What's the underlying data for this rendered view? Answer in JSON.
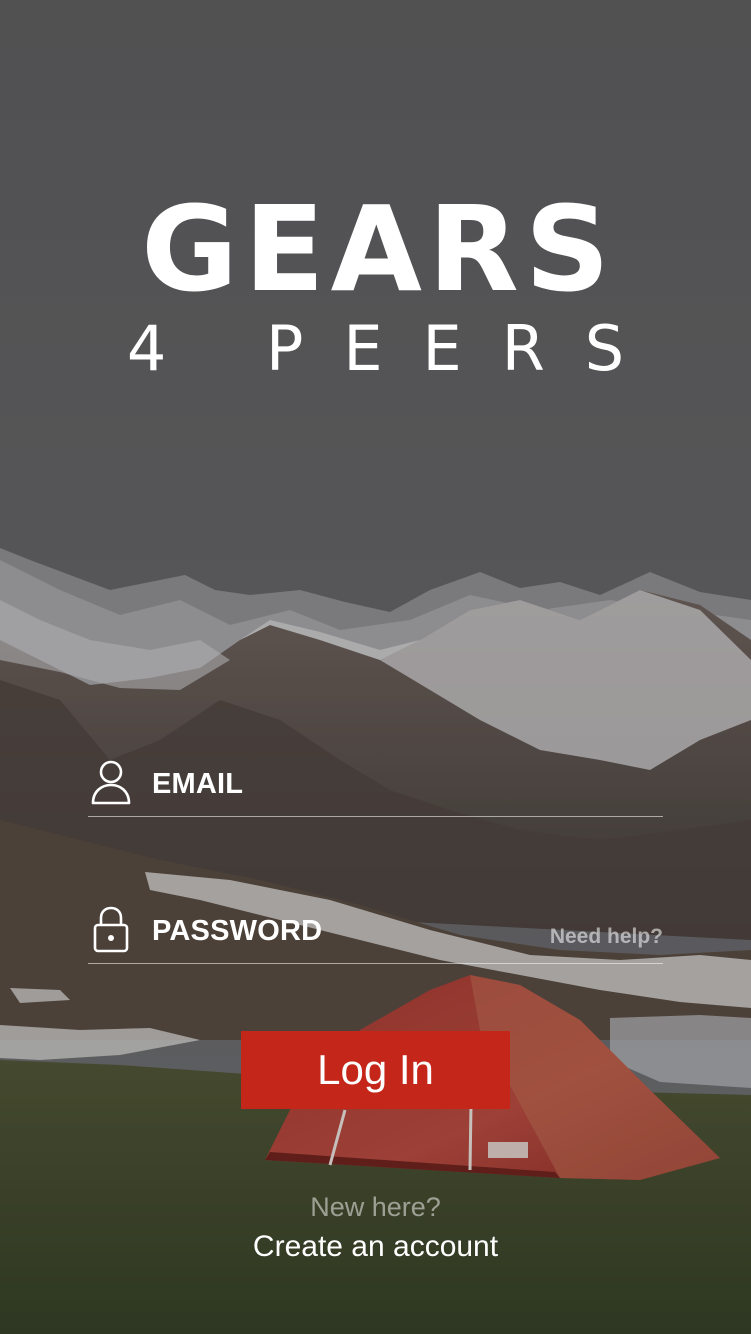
{
  "logo": {
    "title": "GEARS",
    "subtitle": "4 PEERS"
  },
  "form": {
    "email_label": "EMAIL",
    "password_label": "PASSWORD",
    "help_link": "Need help?"
  },
  "login_button": "Log In",
  "signup": {
    "prompt": "New here?",
    "link": "Create an account"
  },
  "icons": {
    "email": "user-icon",
    "password": "lock-icon"
  },
  "colors": {
    "primary": "#c42619"
  }
}
